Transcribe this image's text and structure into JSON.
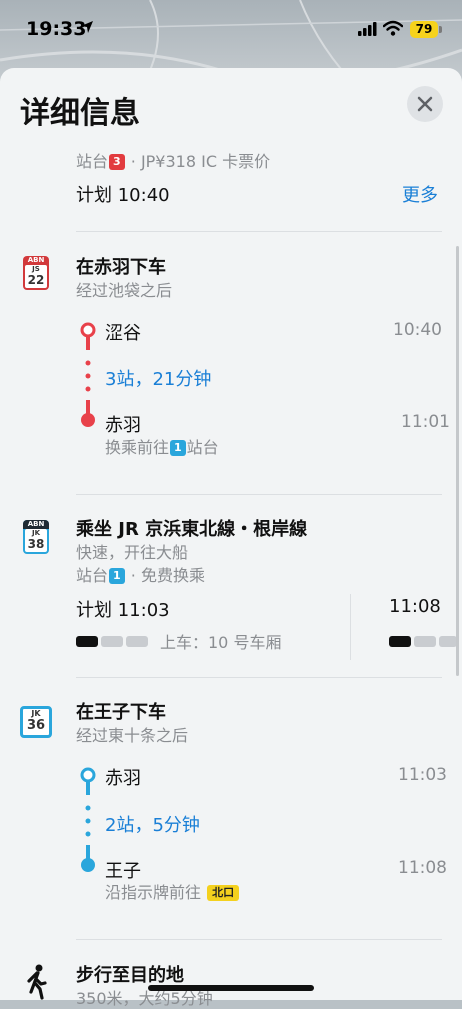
{
  "status": {
    "time": "19:33",
    "battery": "79"
  },
  "header": {
    "title": "详细信息"
  },
  "fare": {
    "prefix": "站台",
    "platform": "3",
    "price": "· JP¥318 IC 卡票价"
  },
  "plan": {
    "label": "计划 10:40",
    "more": "更多"
  },
  "step1": {
    "badge_top": "ABN",
    "badge_code": "JS",
    "badge_num": "22",
    "title": "在赤羽下车",
    "subtitle": "经过池袋之后",
    "from": "涩谷",
    "from_time": "10:40",
    "stops": "3站，21分钟",
    "to": "赤羽",
    "to_time": "11:01",
    "transfer_prefix": "换乘前往",
    "transfer_platform": "1",
    "transfer_suffix": "站台"
  },
  "step2": {
    "badge_top": "ABN",
    "badge_code": "JK",
    "badge_num": "38",
    "title": "乘坐 JR 京浜東北線・根岸線",
    "subtitle": "快速，开往大船",
    "platform_prefix": "站台",
    "platform": "1",
    "platform_suffix": "· 免费换乘",
    "plan": "计划 11:03",
    "next_time": "11:08",
    "boarding": "上车：10 号车厢"
  },
  "step3": {
    "badge_code": "JK",
    "badge_num": "36",
    "title": "在王子下车",
    "subtitle": "经过東十条之后",
    "from": "赤羽",
    "from_time": "11:03",
    "stops": "2站，5分钟",
    "to": "王子",
    "to_time": "11:08",
    "exit_prefix": "沿指示牌前往",
    "exit_label": "北口"
  },
  "step4": {
    "title": "步行至目的地",
    "subtitle": "350米，大约5分钟"
  },
  "colors": {
    "red_line": "#e8414a",
    "blue_line": "#2aa6dc",
    "link_blue": "#1a7fd6",
    "battery": "#f6d21c"
  }
}
